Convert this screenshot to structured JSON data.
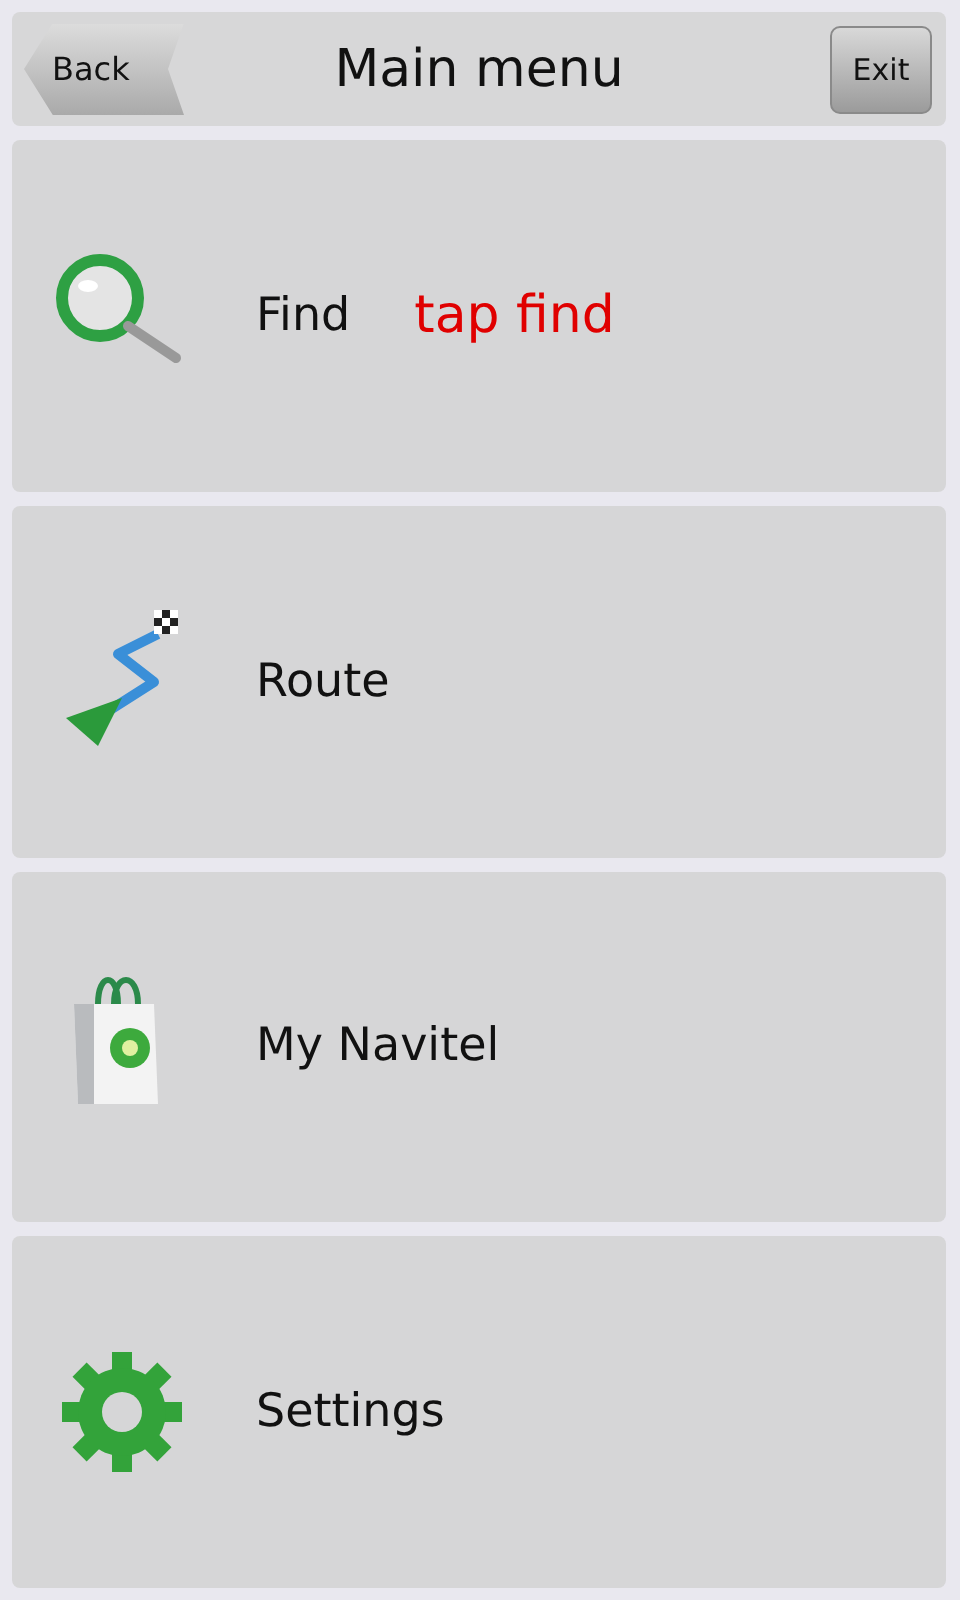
{
  "header": {
    "back": "Back",
    "title": "Main menu",
    "exit": "Exit"
  },
  "menu": [
    {
      "kind": "find",
      "label": "Find",
      "hint": "tap find"
    },
    {
      "kind": "route",
      "label": "Route"
    },
    {
      "kind": "shop",
      "label": "My Navitel"
    },
    {
      "kind": "settings",
      "label": "Settings"
    }
  ]
}
